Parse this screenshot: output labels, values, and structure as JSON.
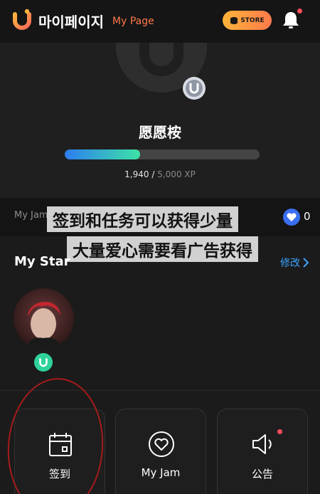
{
  "header": {
    "title": "마이페이지",
    "subtitle": "My Page",
    "store_label": "STORE",
    "bell_icon": "bell-icon",
    "notification_dot": true
  },
  "profile": {
    "nickname": "愿愿桉",
    "xp_current": "1,940",
    "xp_separator": "/",
    "xp_max": "5,000 XP",
    "xp_progress": 0.388,
    "badge_icon": "u-coin-icon"
  },
  "jam": {
    "label": "My Jam",
    "heart_count": "0"
  },
  "captions": {
    "line1": "签到和任务可以获得少量",
    "line2": "大量爱心需要看广告获得"
  },
  "my_star": {
    "title": "My Star",
    "edit_label": "修改"
  },
  "cards": [
    {
      "label": "签到",
      "icon": "calendar-icon"
    },
    {
      "label": "My Jam",
      "icon": "heart-icon"
    },
    {
      "label": "公告",
      "icon": "speaker-icon"
    }
  ],
  "colors": {
    "accent_orange": "#ff7a4a",
    "link_blue": "#3aa4ff",
    "xp_gradient_start": "#2d7df0",
    "xp_gradient_end": "#3de3a6",
    "alert_red": "#ff4d5e"
  }
}
